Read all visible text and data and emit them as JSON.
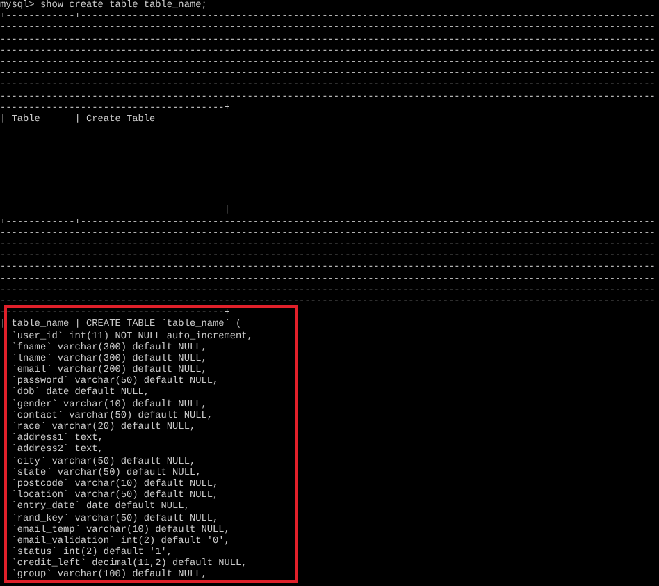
{
  "terminal": {
    "top_output": [
      "mysql> show create table table_name;",
      "+------------+----------------------------------------------------------------------------------------------------",
      "------------------------------------------------------------------------------------------------------------------",
      "------------------------------------------------------------------------------------------------------------------",
      "------------------------------------------------------------------------------------------------------------------",
      "------------------------------------------------------------------------------------------------------------------",
      "------------------------------------------------------------------------------------------------------------------",
      "------------------------------------------------------------------------------------------------------------------",
      "------------------------------------------------------------------------------------------------------------------",
      "---------------------------------------+",
      "| Table      | Create Table"
    ],
    "middle_output": [
      "                                       |",
      "+------------+----------------------------------------------------------------------------------------------------",
      "------------------------------------------------------------------------------------------------------------------",
      "------------------------------------------------------------------------------------------------------------------",
      "------------------------------------------------------------------------------------------------------------------",
      "------------------------------------------------------------------------------------------------------------------",
      "------------------------------------------------------------------------------------------------------------------",
      "------------------------------------------------------------------------------------------------------------------",
      "------------------------------------------------------------------------------------------------------------------"
    ],
    "highlighted_output": [
      "---------------------------------------+",
      "| table_name | CREATE TABLE `table_name` (",
      "  `user_id` int(11) NOT NULL auto_increment,",
      "  `fname` varchar(300) default NULL,",
      "  `lname` varchar(300) default NULL,",
      "  `email` varchar(200) default NULL,",
      "  `password` varchar(50) default NULL,",
      "  `dob` date default NULL,",
      "  `gender` varchar(10) default NULL,",
      "  `contact` varchar(50) default NULL,",
      "  `race` varchar(20) default NULL,",
      "  `address1` text,",
      "  `address2` text,",
      "  `city` varchar(50) default NULL,",
      "  `state` varchar(50) default NULL,",
      "  `postcode` varchar(10) default NULL,",
      "  `location` varchar(50) default NULL,",
      "  `entry_date` date default NULL,",
      "  `rand_key` varchar(50) default NULL,",
      "  `email_temp` varchar(10) default NULL,",
      "  `email_validation` int(2) default '0',",
      "  `status` int(2) default '1',",
      "  `credit_left` decimal(11,2) default NULL,",
      "  `group` varchar(100) default NULL,"
    ]
  }
}
